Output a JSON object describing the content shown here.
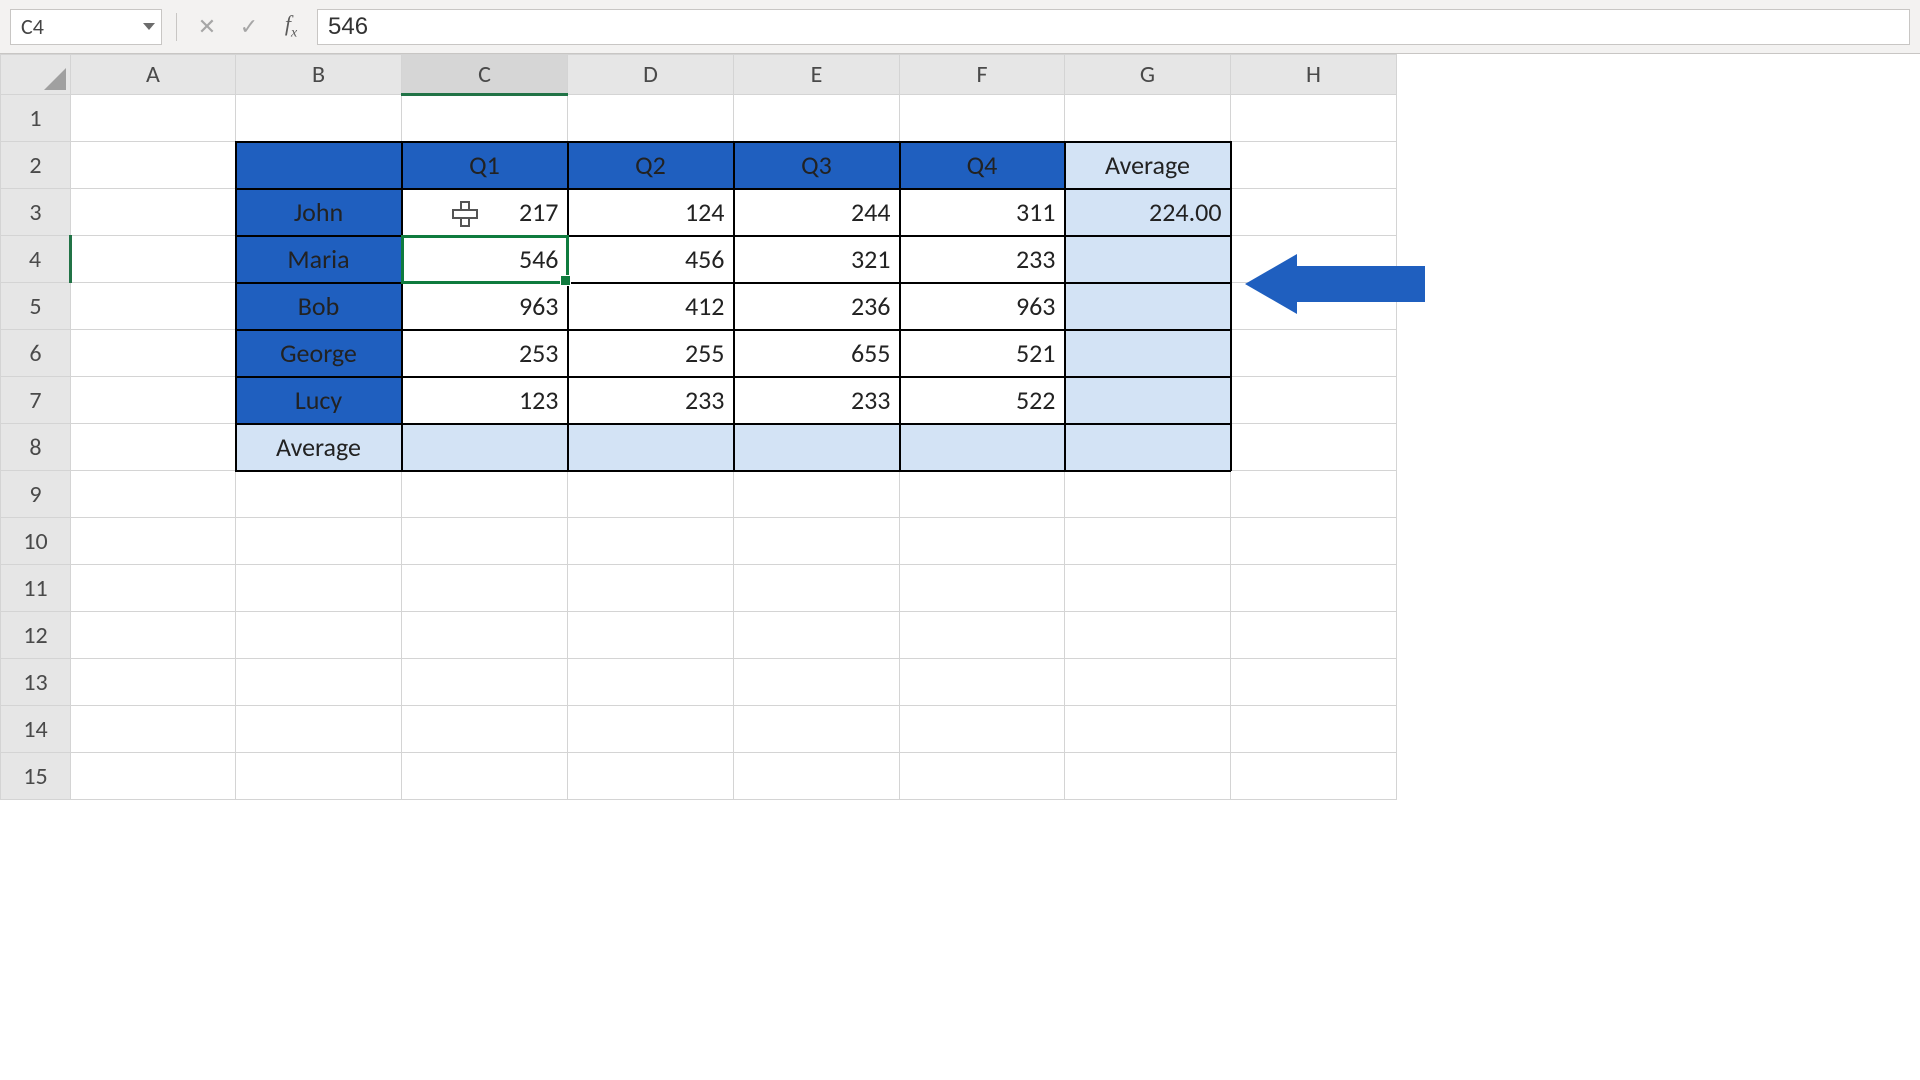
{
  "namebox": "C4",
  "formula_value": "546",
  "columns": [
    "A",
    "B",
    "C",
    "D",
    "E",
    "F",
    "G",
    "H"
  ],
  "rows": [
    "1",
    "2",
    "3",
    "4",
    "5",
    "6",
    "7",
    "8",
    "9",
    "10",
    "11",
    "12",
    "13",
    "14",
    "15"
  ],
  "active_col": "C",
  "active_row": "4",
  "table": {
    "headers": {
      "q1": "Q1",
      "q2": "Q2",
      "q3": "Q3",
      "q4": "Q4",
      "avg": "Average"
    },
    "row_avg_label": "Average",
    "names": {
      "john": "John",
      "maria": "Maria",
      "bob": "Bob",
      "george": "George",
      "lucy": "Lucy"
    },
    "data": {
      "john": {
        "q1": "217",
        "q2": "124",
        "q3": "244",
        "q4": "311",
        "avg": "224.00"
      },
      "maria": {
        "q1": "546",
        "q2": "456",
        "q3": "321",
        "q4": "233"
      },
      "bob": {
        "q1": "963",
        "q2": "412",
        "q3": "236",
        "q4": "963"
      },
      "george": {
        "q1": "253",
        "q2": "255",
        "q3": "655",
        "q4": "521"
      },
      "lucy": {
        "q1": "123",
        "q2": "233",
        "q3": "233",
        "q4": "522"
      }
    }
  }
}
